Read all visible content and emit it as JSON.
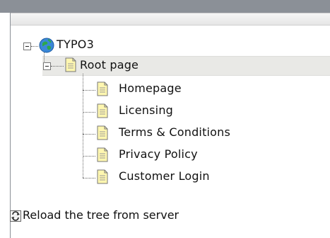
{
  "tree": {
    "root": {
      "label": "TYPO3",
      "icon": "globe-icon",
      "expanded": true
    },
    "page": {
      "label": "Root page",
      "icon": "page-icon",
      "expanded": true,
      "selected": true,
      "children": [
        {
          "label": "Homepage",
          "icon": "page-icon"
        },
        {
          "label": "Licensing",
          "icon": "page-icon"
        },
        {
          "label": "Terms & Conditions",
          "icon": "page-icon"
        },
        {
          "label": "Privacy Policy",
          "icon": "page-icon"
        },
        {
          "label": "Customer Login",
          "icon": "page-icon"
        }
      ]
    }
  },
  "footer": {
    "reload_label": "Reload the tree from server",
    "icon": "reload-icon"
  },
  "colors": {
    "topbar": "#8b9097",
    "selected_row": "#e9e9e6"
  }
}
